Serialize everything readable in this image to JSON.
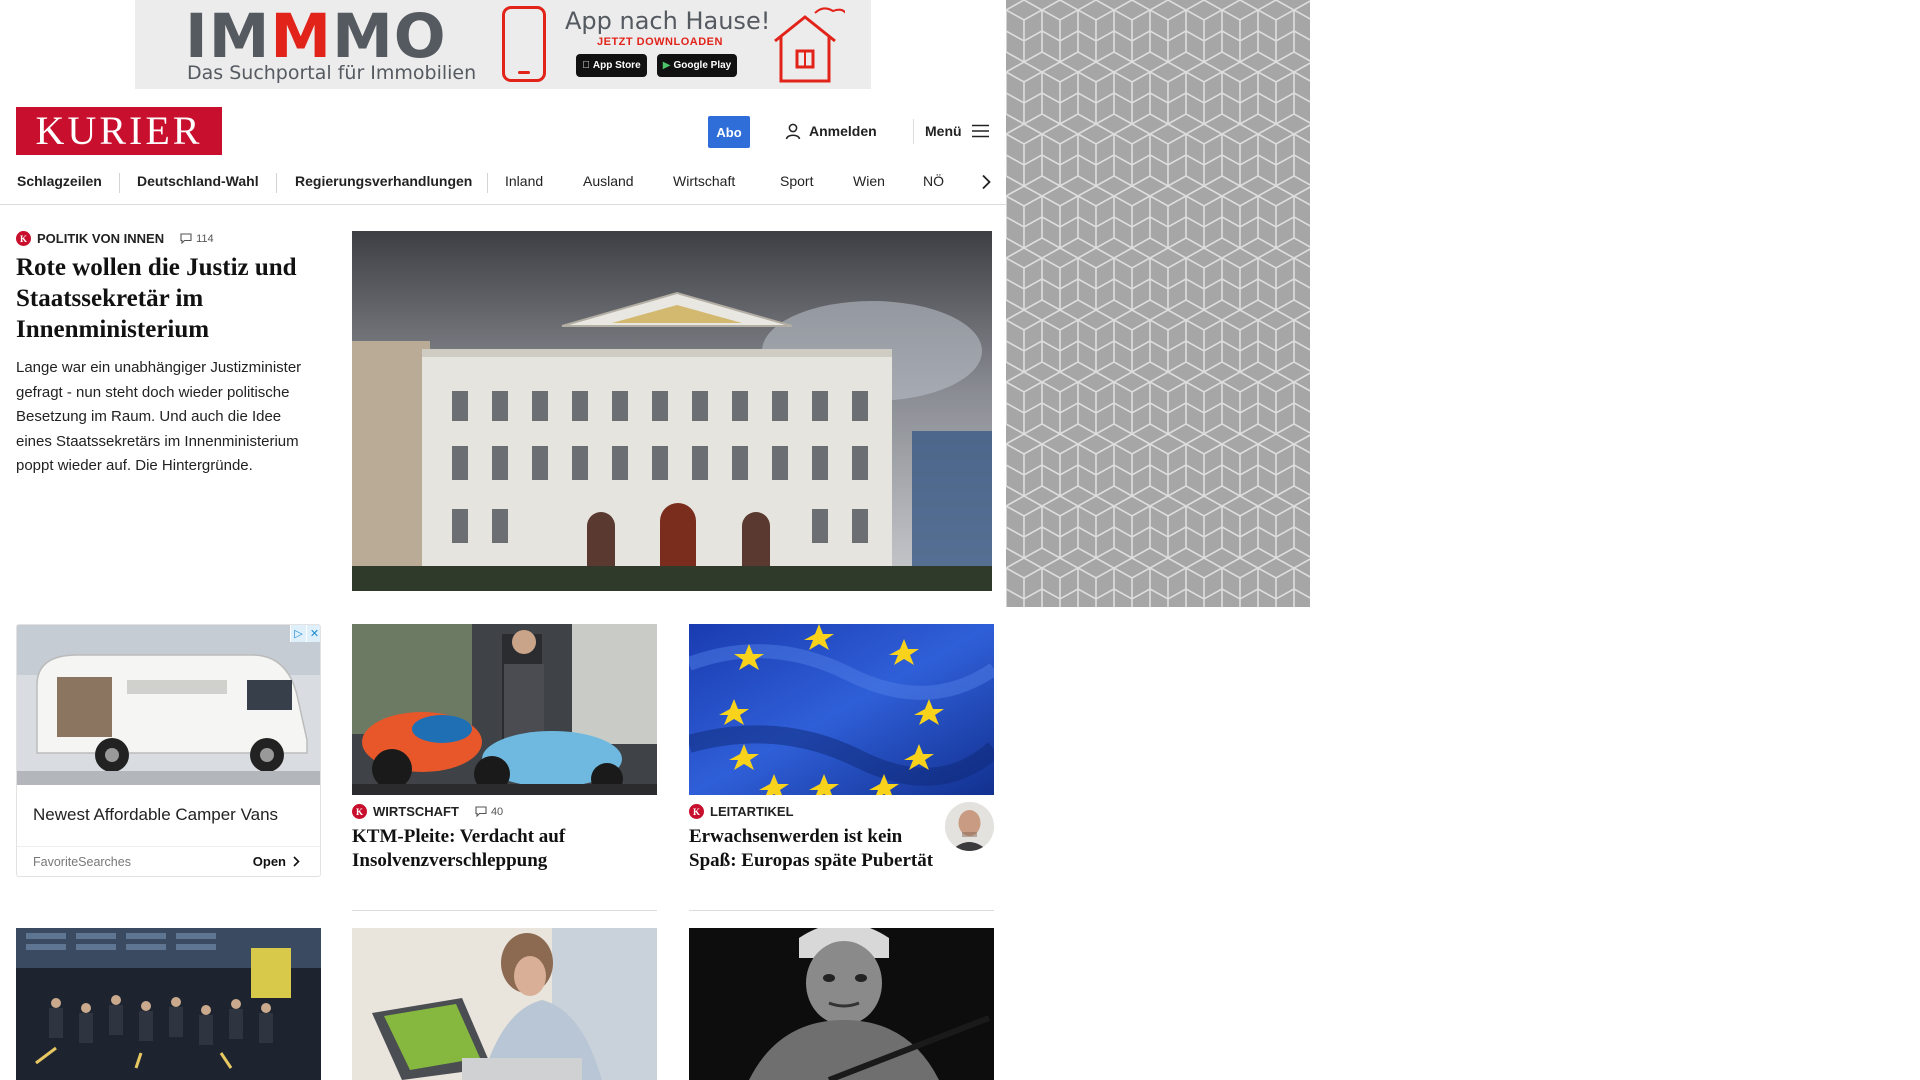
{
  "top_ad": {
    "brand_prefix": "IM",
    "brand_highlight": "M",
    "brand_suffix": "MO",
    "tagline": "Das Suchportal für Immobilien",
    "headline": "App nach Hause!",
    "cta": "JETZT DOWNLOADEN",
    "app_store_label": "App Store",
    "google_play_label": "Google Play"
  },
  "header": {
    "logo": "KURIER",
    "abo_label": "Abo",
    "login_label": "Anmelden",
    "menu_label": "Menü"
  },
  "nav": {
    "items": [
      "Schlagzeilen",
      "Deutschland-Wahl",
      "Regierungsverhandlungen",
      "Inland",
      "Ausland",
      "Wirtschaft",
      "Sport",
      "Wien",
      "NÖ"
    ]
  },
  "lead": {
    "kicker": "POLITIK VON INNEN",
    "comments": "114",
    "title": "Rote wollen die Justiz und Staatssekretär im Innenministerium",
    "teaser": "Lange war ein unabhängiger Justizminister gefragt - nun steht doch wieder politische Besetzung im Raum. Und auch die Idee eines Staatssekretärs im Innenministerium poppt wieder auf. Die Hintergründe."
  },
  "native_ad": {
    "title": "Newest Affordable Camper Vans",
    "source": "FavoriteSearches",
    "open_label": "Open"
  },
  "cards": [
    {
      "kicker": "WIRTSCHAFT",
      "comments": "40",
      "title": "KTM-Pleite: Verdacht auf Insolvenzverschleppung"
    },
    {
      "kicker": "LEITARTIKEL",
      "title": "Erwachsenwerden ist kein Spaß: Europas späte Pubertät"
    }
  ],
  "colors": {
    "brand_red": "#c8102e",
    "abo_blue": "#2f6ed8",
    "ad_red": "#e2231a"
  }
}
